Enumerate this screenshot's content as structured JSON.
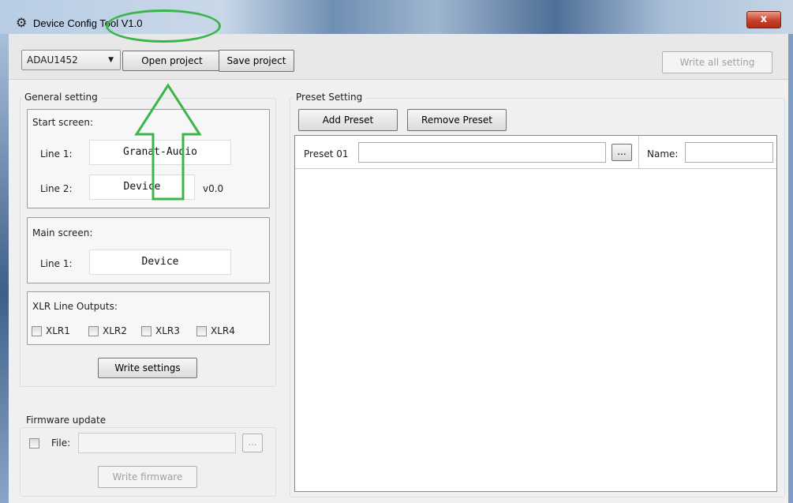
{
  "window": {
    "title": "Device Config Tool V1.0",
    "close_label": "x",
    "icon": "gear-icon"
  },
  "toolbar": {
    "device_select": "ADAU1452",
    "open_project": "Open project",
    "save_project": "Save project",
    "write_all": "Write all setting"
  },
  "general": {
    "legend": "General setting",
    "start_screen": {
      "title": "Start screen:",
      "line1_label": "Line 1:",
      "line1_value": "Granat-Audio",
      "line2_label": "Line 2:",
      "line2_value": "Device",
      "version": "v0.0"
    },
    "main_screen": {
      "title": "Main screen:",
      "line1_label": "Line 1:",
      "line1_value": "Device"
    },
    "xlr": {
      "title": "XLR Line Outputs:",
      "outputs": [
        "XLR1",
        "XLR2",
        "XLR3",
        "XLR4"
      ]
    },
    "write_settings": "Write settings"
  },
  "firmware": {
    "legend": "Firmware update",
    "file_label": "File:",
    "browse": "...",
    "write_firmware": "Write firmware"
  },
  "preset": {
    "legend": "Preset Setting",
    "add": "Add Preset",
    "remove": "Remove Preset",
    "rows": [
      {
        "label": "Preset 01",
        "path": "",
        "browse": "...",
        "name_label": "Name:",
        "name_value": ""
      }
    ]
  },
  "colors": {
    "highlight": "#3bb54a",
    "close_button": "#c7402b"
  }
}
